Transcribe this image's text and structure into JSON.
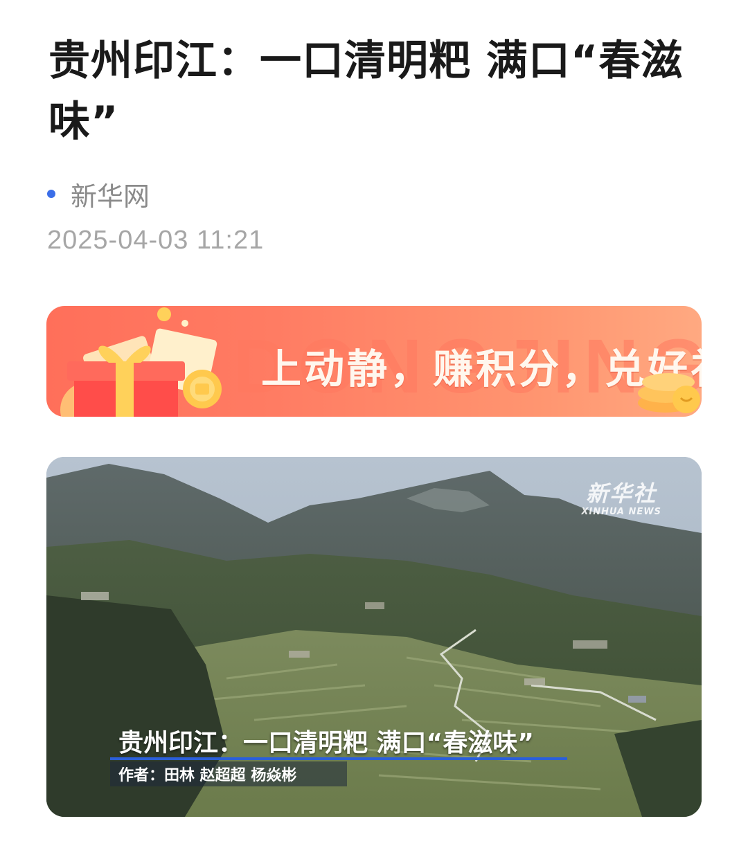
{
  "article": {
    "title": "贵州印江：一口清明粑 满口“春滋味”",
    "source": "新华网",
    "timestamp": "2025-04-03 11:21"
  },
  "banner": {
    "text": "上动静，赚积分，兑好礼",
    "watermark": "DONGJING",
    "gradient_colors": [
      "#ff6f5a",
      "#ffa981"
    ]
  },
  "video": {
    "logo_cn": "新华社",
    "logo_en": "XINHUA NEWS",
    "caption_title": "贵州印江：一口清明粑 满口“春滋味”",
    "caption_author": "作者：田林 赵超超 杨焱彬"
  },
  "colors": {
    "source_dot": "#3b6ee8",
    "title_text": "#1a1a1a",
    "meta_text": "#8a8a8a",
    "caption_line": "#2b5fd9"
  }
}
